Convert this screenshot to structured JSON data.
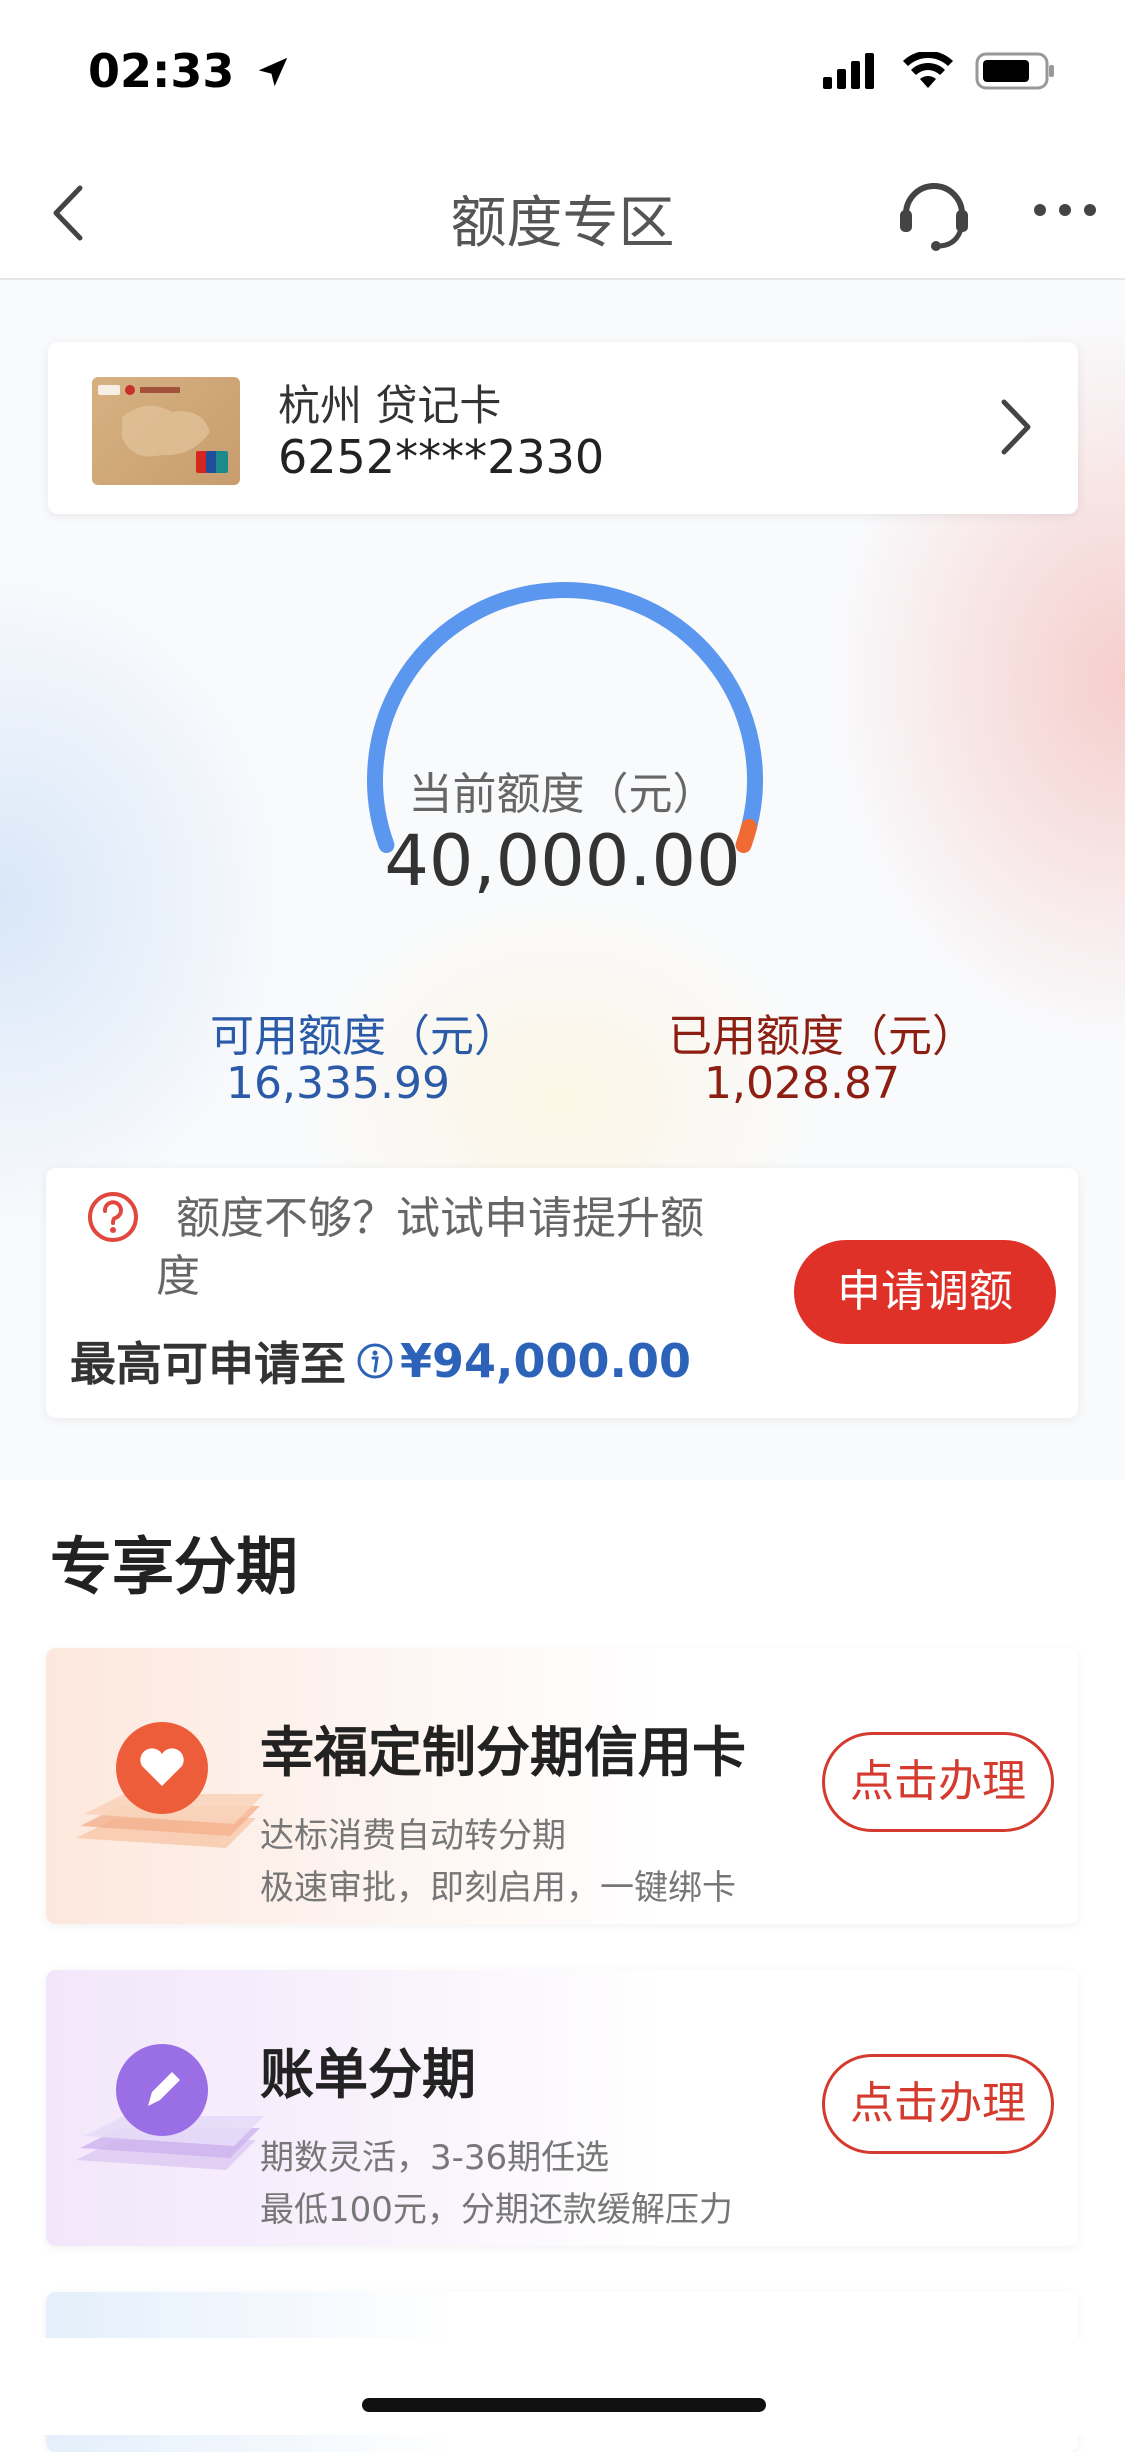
{
  "status_bar": {
    "time": "02:33"
  },
  "nav": {
    "title": "额度专区"
  },
  "card": {
    "name": "杭州 贷记卡",
    "number": "6252****2330"
  },
  "gauge": {
    "current_label": "当前额度（元）",
    "current_value": "40,000.00",
    "used_fraction": 0.026,
    "available_label": "可用额度（元）",
    "available_value": "16,335.99",
    "used_label": "已用额度（元）",
    "used_value": "1,028.87",
    "colors": {
      "track": "#5b96ef",
      "used": "#f06a34"
    }
  },
  "raise": {
    "tip_line1": "额度不够？试试申请提升额",
    "tip_line2": "度",
    "max_label": "最高可申请至",
    "max_amount": "¥94,000.00",
    "button": "申请调额"
  },
  "section": {
    "title": "专享分期"
  },
  "promos": [
    {
      "title": "幸福定制分期信用卡",
      "sub1": "达标消费自动转分期",
      "sub2": "极速审批，即刻启用，一键绑卡",
      "button": "点击办理"
    },
    {
      "title": "账单分期",
      "sub1": "期数灵活，3-36期任选",
      "sub2": "最低100元，分期还款缓解压力",
      "button": "点击办理"
    }
  ],
  "colors": {
    "accent_red": "#e03129",
    "link_blue": "#2c62b8"
  }
}
